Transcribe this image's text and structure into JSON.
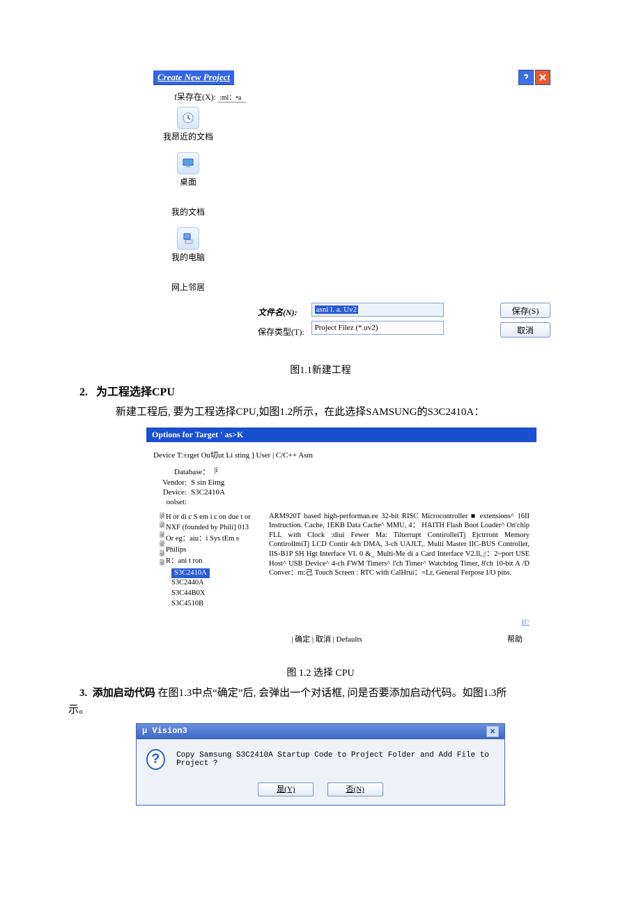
{
  "dlg1": {
    "title": "Create New Project",
    "savein_label": "f呆存在(X):",
    "savein_value": ":ml：•a",
    "places": [
      {
        "label": "我昂近的文档"
      },
      {
        "label": "桌面"
      },
      {
        "label": "我的文档"
      },
      {
        "label": "我的电脑"
      },
      {
        "label": "网上邻居"
      }
    ],
    "filename_label": "文件名(N):",
    "filename_value": "asni l. a. Uv2",
    "filetype_label": "保存类型(T):",
    "filetype_value": "Project Filez (*.uv2)",
    "save_btn": "保存(S)",
    "cancel_btn": "取消",
    "caption": "图1.1新建工程"
  },
  "section2": {
    "heading_num": "2.",
    "heading": "为工程选择CPU",
    "body": "新建工程后, 要为工程选择CPU,如图1.2所示，在此选择SAMSUNG的S3C2410A："
  },
  "dlg2": {
    "title": "Options for Target ' as>K",
    "tabs": "Device T:±rget Ou切ut Li sting ] User | C/C++ Asm",
    "database_label": "Database：",
    "database_value": "|i",
    "vendor_label": "Vendor:",
    "vendor_value": "S sin Eimg",
    "device_label": "Device:",
    "device_value": "S3C2410A",
    "toolset_label": "oolset:",
    "tree": [
      "H or di c S em i c on due t or",
      "NXF (founded by Phili] 013",
      "Or eg：aiu：i Sys tEm s",
      "Philips",
      "R：ani t ron"
    ],
    "tree_sub": [
      "S3C2410A",
      "S3C2440A",
      "S3C44B0X",
      "S3C4510B"
    ],
    "desc": "ARM920T based high-performan.ee 32-bit RISC Microcontroller ■ extensions^ 16II Instruction. Cache, 1EKB Data Cache^ MMU, 4： HAITH Flash Boot Loader^ On'chip FLL with Clock :diui Fewer Ma: Tilterrupt ContirolleiTj Ejctrront Memory ContirollmiTj LCD Contir 4ch DMA, 3-ch UAJLT,. Multi Master IIC-BUS Controller, IIS-B1P SH Hgt Interface VI. 0 &_ Multi-Me di a Card Interface V2.ll,』：2~port USE Host^ USB Device^ 4-ch FWM Timers^ l'ch Timer^ Watchdog Timer, 8'ch 10-bit A /D Conver：m:己    Touch Screen : RTC with CalHrui：=Lr, General Ferpose I/O pins.",
    "hv": "H'/",
    "btns": "| 确定  |  取消  | Defaults",
    "help": "帮助",
    "caption": "图 1.2 选择 CPU"
  },
  "section3": {
    "heading_num": "3.",
    "heading_strong": "添加启动代码",
    "heading_rest": "  在图1.3中点“确定”后, 会弹出一个对话框, 问是否要添加启动代码。如图1.3所",
    "tail": "示。"
  },
  "dlg3": {
    "title": "μ Vision3",
    "msg": "Copy Samsung S3C2410A Startup Code to Project Folder and Add File to Project ?",
    "yes": "是(Y)",
    "no": "否(N)"
  }
}
